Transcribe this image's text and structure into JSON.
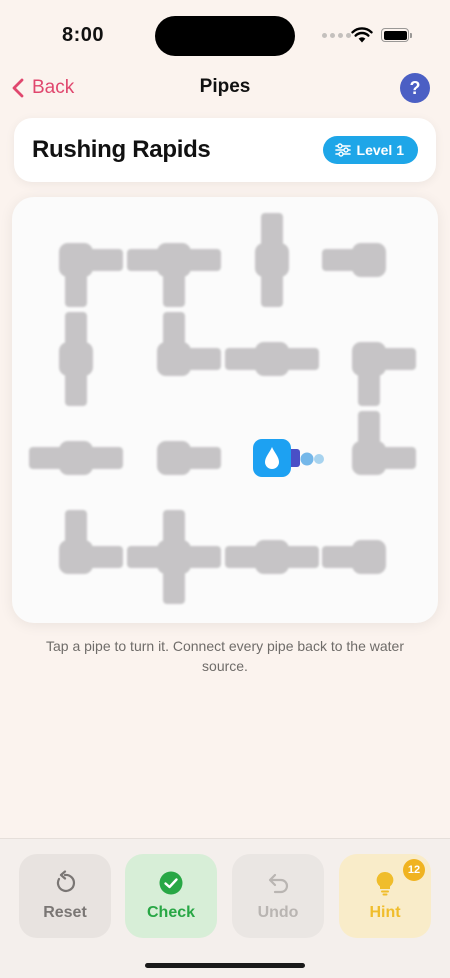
{
  "status": {
    "time": "8:00"
  },
  "nav": {
    "back_label": "Back",
    "title": "Pipes",
    "help_label": "?"
  },
  "level": {
    "name": "Rushing Rapids",
    "badge_label": "Level 1"
  },
  "board": {
    "rows": 4,
    "cols": 4,
    "source": {
      "row": 2,
      "col": 2,
      "icon": "water-drop-icon",
      "color": "#1da1f2"
    },
    "pipe_color": "#c6c4c6",
    "tiles": [
      {
        "row": 0,
        "col": 0,
        "type": "elbow",
        "arms": [
          "E",
          "S"
        ]
      },
      {
        "row": 0,
        "col": 1,
        "type": "tee",
        "arms": [
          "W",
          "E",
          "S"
        ]
      },
      {
        "row": 0,
        "col": 2,
        "type": "straight",
        "arms": [
          "N",
          "S"
        ]
      },
      {
        "row": 0,
        "col": 3,
        "type": "end",
        "arms": [
          "W"
        ]
      },
      {
        "row": 1,
        "col": 0,
        "type": "straight",
        "arms": [
          "N",
          "S"
        ]
      },
      {
        "row": 1,
        "col": 1,
        "type": "elbow",
        "arms": [
          "N",
          "E"
        ]
      },
      {
        "row": 1,
        "col": 2,
        "type": "straight",
        "arms": [
          "W",
          "E"
        ]
      },
      {
        "row": 1,
        "col": 3,
        "type": "elbow",
        "arms": [
          "E",
          "S"
        ]
      },
      {
        "row": 2,
        "col": 0,
        "type": "straight",
        "arms": [
          "W",
          "E"
        ]
      },
      {
        "row": 2,
        "col": 1,
        "type": "end",
        "arms": [
          "E"
        ]
      },
      {
        "row": 2,
        "col": 3,
        "type": "elbow",
        "arms": [
          "N",
          "E"
        ]
      },
      {
        "row": 3,
        "col": 0,
        "type": "elbow",
        "arms": [
          "N",
          "E"
        ]
      },
      {
        "row": 3,
        "col": 1,
        "type": "cross",
        "arms": [
          "N",
          "S",
          "W",
          "E"
        ]
      },
      {
        "row": 3,
        "col": 2,
        "type": "straight",
        "arms": [
          "W",
          "E"
        ]
      },
      {
        "row": 3,
        "col": 3,
        "type": "end",
        "arms": [
          "W"
        ]
      }
    ]
  },
  "instructions": "Tap a pipe to turn it. Connect every pipe back to the water source.",
  "actions": {
    "reset_label": "Reset",
    "check_label": "Check",
    "undo_label": "Undo",
    "hint_label": "Hint",
    "hint_count": "12"
  },
  "colors": {
    "accent": "#e0476e",
    "badge": "#1ea6e8",
    "water": "#1da1f2",
    "flow": "#4a4fc6",
    "check_green": "#28a745",
    "hint_yellow": "#f0bd2b"
  }
}
